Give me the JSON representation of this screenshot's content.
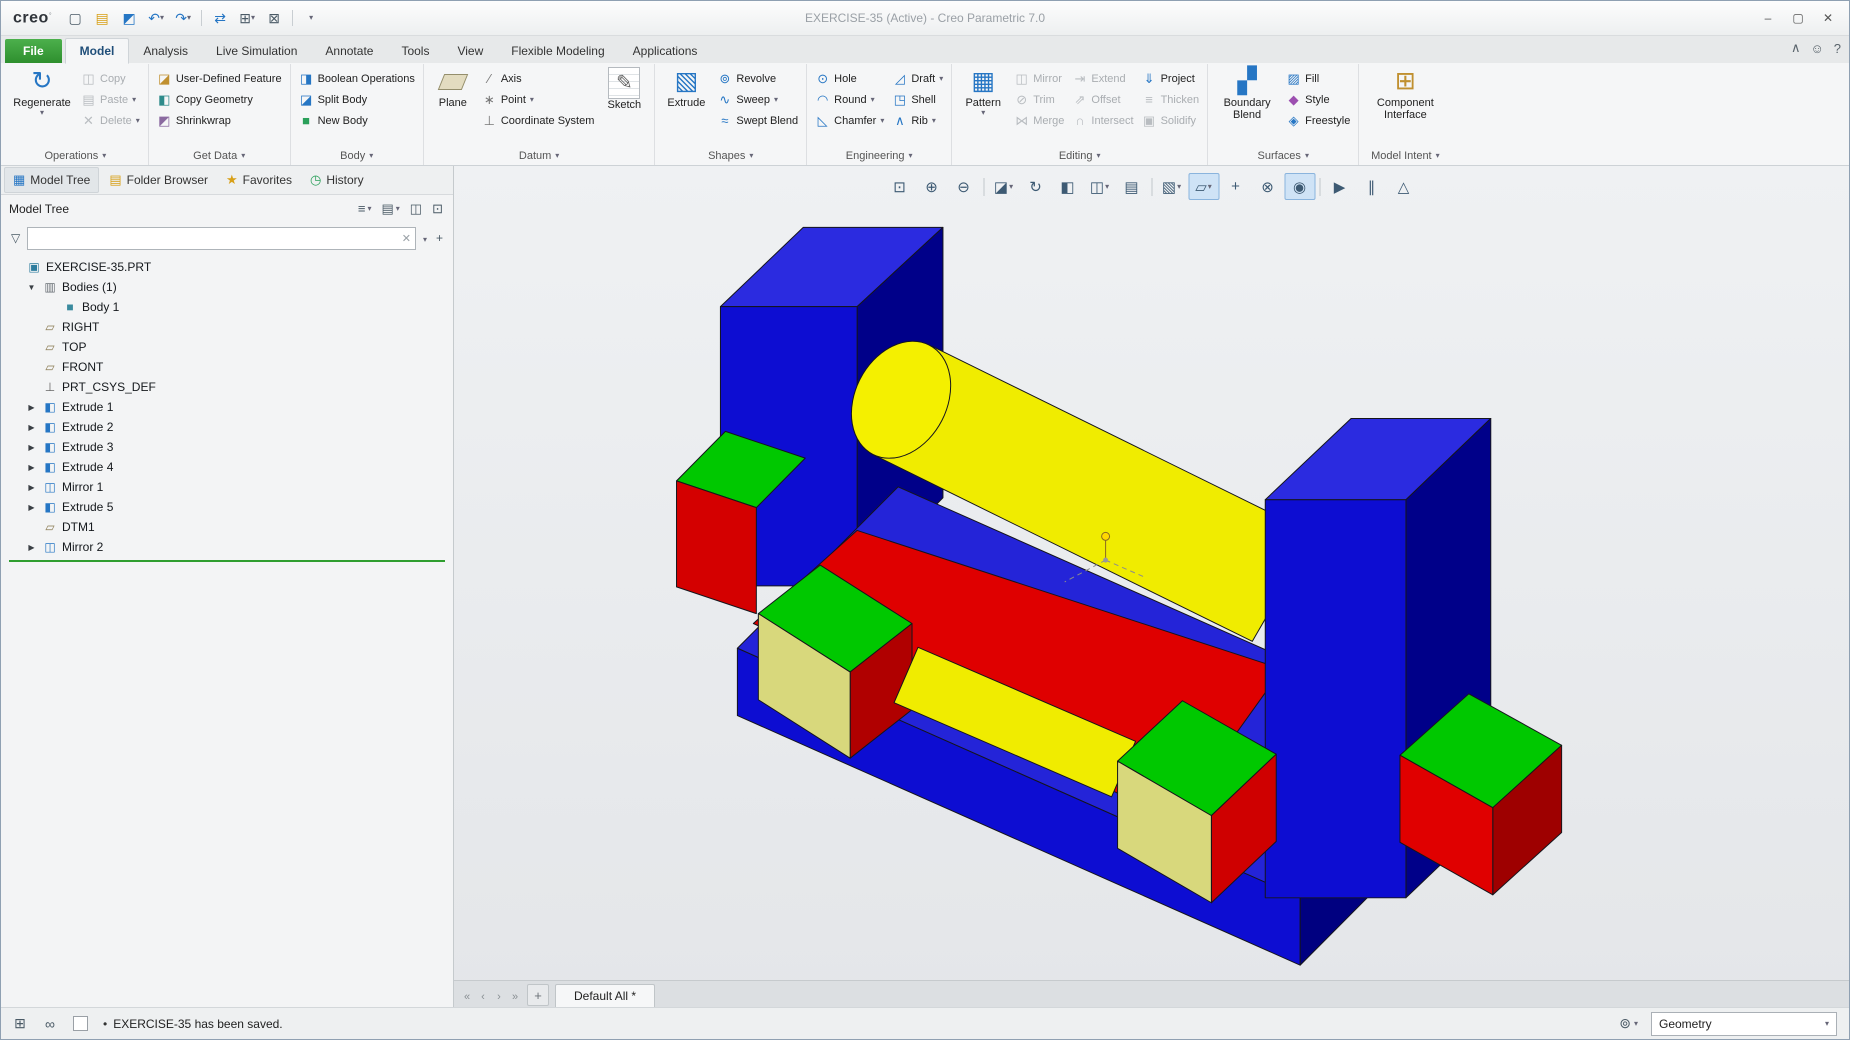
{
  "window": {
    "brand": "creo",
    "title": "EXERCISE-35 (Active) - Creo Parametric 7.0"
  },
  "tabs": [
    "File",
    "Model",
    "Analysis",
    "Live Simulation",
    "Annotate",
    "Tools",
    "View",
    "Flexible Modeling",
    "Applications"
  ],
  "ribbon": {
    "groups": [
      {
        "label": "Operations",
        "big": [
          {
            "label": "Regenerate"
          }
        ],
        "small": [
          {
            "label": "Copy"
          },
          {
            "label": "Paste"
          },
          {
            "label": "Delete"
          }
        ]
      },
      {
        "label": "Get Data",
        "small": [
          {
            "label": "User-Defined Feature"
          },
          {
            "label": "Copy Geometry"
          },
          {
            "label": "Shrinkwrap"
          }
        ]
      },
      {
        "label": "Body",
        "small": [
          {
            "label": "Boolean Operations"
          },
          {
            "label": "Split Body"
          },
          {
            "label": "New Body"
          }
        ]
      },
      {
        "label": "Datum",
        "big": [
          {
            "label": "Plane"
          },
          {
            "label": "Sketch"
          }
        ],
        "small": [
          {
            "label": "Axis"
          },
          {
            "label": "Point"
          },
          {
            "label": "Coordinate System"
          }
        ]
      },
      {
        "label": "Shapes",
        "big": [
          {
            "label": "Extrude"
          }
        ],
        "small": [
          {
            "label": "Revolve"
          },
          {
            "label": "Sweep"
          },
          {
            "label": "Swept Blend"
          }
        ]
      },
      {
        "label": "Engineering",
        "small": [
          {
            "label": "Hole"
          },
          {
            "label": "Round"
          },
          {
            "label": "Chamfer"
          },
          {
            "label": "Draft"
          },
          {
            "label": "Shell"
          },
          {
            "label": "Rib"
          }
        ]
      },
      {
        "label": "Editing",
        "big": [
          {
            "label": "Pattern"
          }
        ],
        "small": [
          {
            "label": "Mirror"
          },
          {
            "label": "Trim"
          },
          {
            "label": "Merge"
          },
          {
            "label": "Extend"
          },
          {
            "label": "Offset"
          },
          {
            "label": "Intersect"
          },
          {
            "label": "Project"
          },
          {
            "label": "Thicken"
          },
          {
            "label": "Solidify"
          }
        ]
      },
      {
        "label": "Surfaces",
        "big": [
          {
            "label": "Boundary Blend"
          }
        ],
        "small": [
          {
            "label": "Fill"
          },
          {
            "label": "Style"
          },
          {
            "label": "Freestyle"
          }
        ]
      },
      {
        "label": "Model Intent",
        "big": [
          {
            "label": "Component Interface"
          }
        ]
      }
    ]
  },
  "navigator": {
    "tabs": [
      "Model Tree",
      "Folder Browser",
      "Favorites",
      "History"
    ]
  },
  "model_tree": {
    "title": "Model Tree",
    "items": [
      {
        "label": "EXERCISE-35.PRT",
        "exp": ""
      },
      {
        "label": "Bodies (1)",
        "exp": "▼"
      },
      {
        "label": "Body 1",
        "exp": ""
      },
      {
        "label": "RIGHT",
        "exp": ""
      },
      {
        "label": "TOP",
        "exp": ""
      },
      {
        "label": "FRONT",
        "exp": ""
      },
      {
        "label": "PRT_CSYS_DEF",
        "exp": ""
      },
      {
        "label": "Extrude 1",
        "exp": "▶"
      },
      {
        "label": "Extrude 2",
        "exp": "▶"
      },
      {
        "label": "Extrude 3",
        "exp": "▶"
      },
      {
        "label": "Extrude 4",
        "exp": "▶"
      },
      {
        "label": "Mirror 1",
        "exp": "▶"
      },
      {
        "label": "Extrude 5",
        "exp": "▶"
      },
      {
        "label": "DTM1",
        "exp": ""
      },
      {
        "label": "Mirror 2",
        "exp": "▶"
      }
    ]
  },
  "graphics": {
    "view_tab": "Default All *"
  },
  "status": {
    "message": "EXERCISE-35 has been saved.",
    "selector": "Geometry"
  },
  "palette": {
    "model_blue_top": "#2b2be0",
    "model_blue_front": "#0d0dd2",
    "model_blue_dark": "#000089",
    "model_yellow": "#f0ec00",
    "model_red": "#e00000",
    "model_green": "#00c800",
    "model_khaki": "#d8d87c",
    "file_tab_green": "#2e8f2e",
    "active_tab_text": "#1f4e79",
    "toolbar_toggle_bg": "#cfe3f6"
  }
}
